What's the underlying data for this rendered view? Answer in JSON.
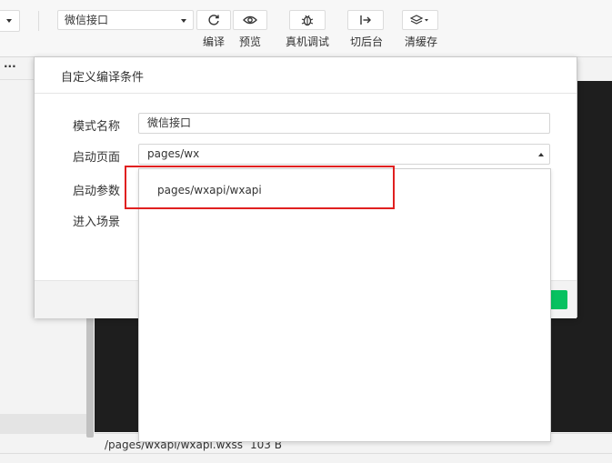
{
  "toolbar": {
    "mode_select_value": "微信接口",
    "tools": [
      {
        "label": "编译",
        "icon": "refresh-icon"
      },
      {
        "label": "预览",
        "icon": "eye-icon"
      },
      {
        "label": "真机调试",
        "icon": "bug-icon"
      },
      {
        "label": "切后台",
        "icon": "switch-background-icon"
      },
      {
        "label": "清缓存",
        "icon": "layers-icon"
      }
    ]
  },
  "left_panel": {
    "menu_glyph": "···"
  },
  "dialog": {
    "title": "自定义编译条件",
    "fields": [
      {
        "label": "模式名称",
        "value": "微信接口"
      },
      {
        "label": "启动页面",
        "value": "pages/wx"
      },
      {
        "label": "启动参数",
        "value": ""
      },
      {
        "label": "进入场景",
        "value": ""
      }
    ],
    "dropdown_options": [
      "pages/wxapi/wxapi"
    ]
  },
  "status": {
    "path": "/pages/wxapi/wxapi.wxss",
    "size": "103 B"
  },
  "colors": {
    "accent": "#07c160",
    "highlight": "#e02020",
    "dark_editor": "#1e1e1e"
  }
}
